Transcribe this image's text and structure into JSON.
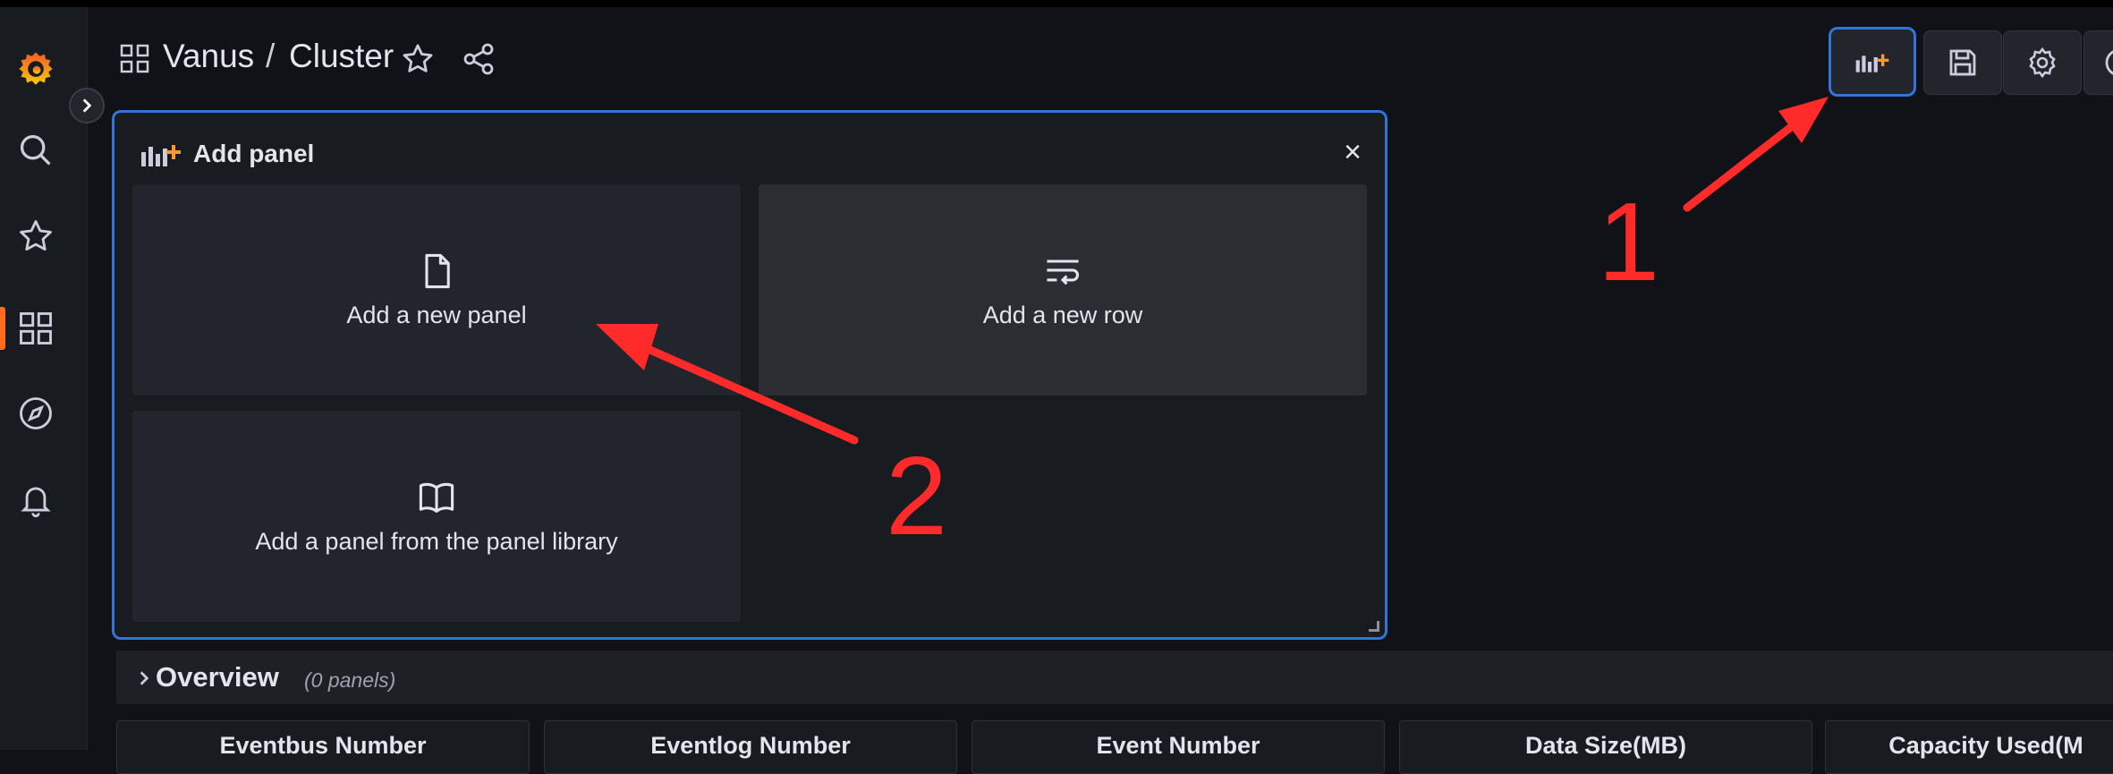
{
  "header": {
    "folder": "Vanus",
    "separator": "/",
    "title": "Cluster"
  },
  "add_panel": {
    "title": "Add panel",
    "close": "×",
    "options": [
      {
        "label": "Add a new panel",
        "icon": "file-icon"
      },
      {
        "label": "Add a new row",
        "icon": "row-icon"
      },
      {
        "label": "Add a panel from the panel library",
        "icon": "book-icon"
      }
    ]
  },
  "row": {
    "title": "Overview",
    "count": "(0 panels)"
  },
  "stats": [
    {
      "title": "Eventbus Number"
    },
    {
      "title": "Eventlog Number"
    },
    {
      "title": "Event Number"
    },
    {
      "title": "Data Size(MB)"
    },
    {
      "title": "Capacity Used(M"
    }
  ],
  "annotations": {
    "step1": "1",
    "step2": "2"
  },
  "colors": {
    "background": "#111217",
    "panel": "#181b1f",
    "card": "#22252b",
    "accent_blue": "#3274d9",
    "brand_orange": "#ff6b1f",
    "annotation_red": "#ff2a2a"
  }
}
